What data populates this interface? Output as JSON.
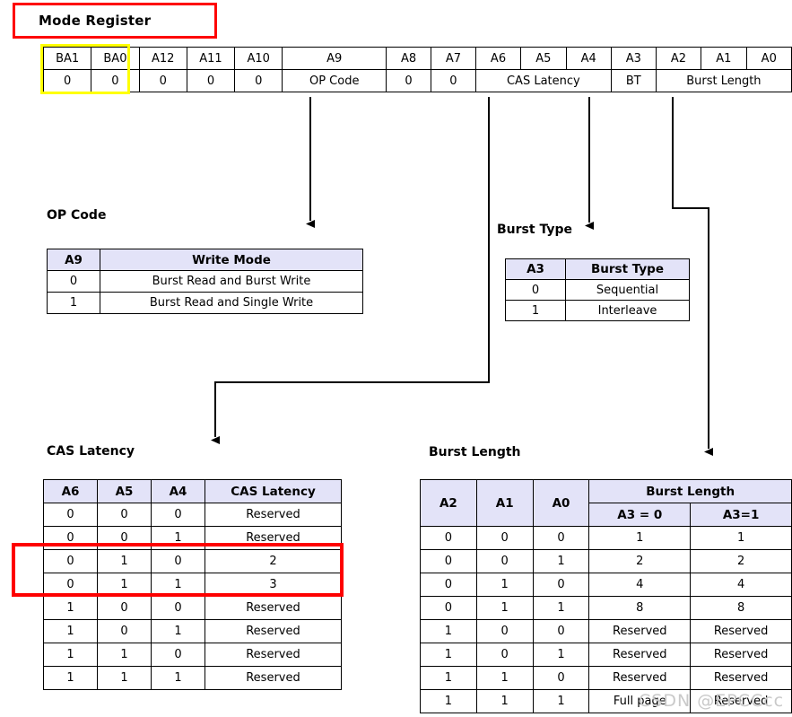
{
  "title": {
    "label": "Mode Register"
  },
  "mode_register": {
    "bits": [
      {
        "name": "BA1",
        "value": "0",
        "span": 1
      },
      {
        "name": "BA0",
        "value": "0",
        "span": 1
      },
      {
        "name": "A12",
        "value": "0",
        "span": 1
      },
      {
        "name": "A11",
        "value": "0",
        "span": 1
      },
      {
        "name": "A10",
        "value": "0",
        "span": 1
      },
      {
        "name": "A9",
        "value": "OP Code",
        "span": 1
      },
      {
        "name": "A8",
        "value": "0",
        "span": 1
      },
      {
        "name": "A7",
        "value": "0",
        "span": 1
      },
      {
        "name": "A6",
        "value": "",
        "span": 1
      },
      {
        "name": "A5",
        "value": "",
        "span": 1
      },
      {
        "name": "A4",
        "value": "",
        "span": 1
      },
      {
        "name": "A3",
        "value": "BT",
        "span": 1
      },
      {
        "name": "A2",
        "value": "",
        "span": 1
      },
      {
        "name": "A1",
        "value": "",
        "span": 1
      },
      {
        "name": "A0",
        "value": "",
        "span": 1
      }
    ],
    "names_row": [
      "BA1",
      "BA0",
      "A12",
      "A11",
      "A10",
      "A9",
      "A8",
      "A7",
      "A6",
      "A5",
      "A4",
      "A3",
      "A2",
      "A1",
      "A0"
    ],
    "values_row": [
      "0",
      "0",
      "0",
      "0",
      "0",
      "OP Code",
      "0",
      "0",
      "CAS Latency",
      "BT",
      "Burst Length"
    ],
    "merged_labels": {
      "cas_latency": "CAS Latency",
      "burst_type": "BT",
      "burst_length": "Burst Length"
    }
  },
  "op_code": {
    "caption": "OP Code",
    "headers": [
      "A9",
      "Write Mode"
    ],
    "rows": [
      [
        "0",
        "Burst Read and Burst Write"
      ],
      [
        "1",
        "Burst Read and Single Write"
      ]
    ]
  },
  "burst_type": {
    "caption": "Burst Type",
    "headers": [
      "A3",
      "Burst Type"
    ],
    "rows": [
      [
        "0",
        "Sequential"
      ],
      [
        "1",
        "Interleave"
      ]
    ]
  },
  "cas_latency": {
    "caption": "CAS Latency",
    "headers": [
      "A6",
      "A5",
      "A4",
      "CAS Latency"
    ],
    "rows": [
      [
        "0",
        "0",
        "0",
        "Reserved"
      ],
      [
        "0",
        "0",
        "1",
        "Reserved"
      ],
      [
        "0",
        "1",
        "0",
        "2"
      ],
      [
        "0",
        "1",
        "1",
        "3"
      ],
      [
        "1",
        "0",
        "0",
        "Reserved"
      ],
      [
        "1",
        "0",
        "1",
        "Reserved"
      ],
      [
        "1",
        "1",
        "0",
        "Reserved"
      ],
      [
        "1",
        "1",
        "1",
        "Reserved"
      ]
    ],
    "highlighted_rows": [
      2,
      3
    ]
  },
  "burst_length": {
    "caption": "Burst Length",
    "group_header": "Burst Length",
    "headers": [
      "A2",
      "A1",
      "A0"
    ],
    "sub_headers": [
      "A3 = 0",
      "A3=1"
    ],
    "rows": [
      [
        "0",
        "0",
        "0",
        "1",
        "1"
      ],
      [
        "0",
        "0",
        "1",
        "2",
        "2"
      ],
      [
        "0",
        "1",
        "0",
        "4",
        "4"
      ],
      [
        "0",
        "1",
        "1",
        "8",
        "8"
      ],
      [
        "1",
        "0",
        "0",
        "Reserved",
        "Reserved"
      ],
      [
        "1",
        "0",
        "1",
        "Reserved",
        "Reserved"
      ],
      [
        "1",
        "1",
        "0",
        "Reserved",
        "Reserved"
      ],
      [
        "1",
        "1",
        "1",
        "Full page",
        "Reserved"
      ]
    ]
  },
  "watermark": {
    "text": "CSDN @EPCCcc"
  },
  "colors": {
    "highlight_red": "#fe0000",
    "highlight_yellow": "#ffff00",
    "table_header": "#e3e3f8",
    "line": "#000000",
    "watermark": "#c9c9c9"
  }
}
